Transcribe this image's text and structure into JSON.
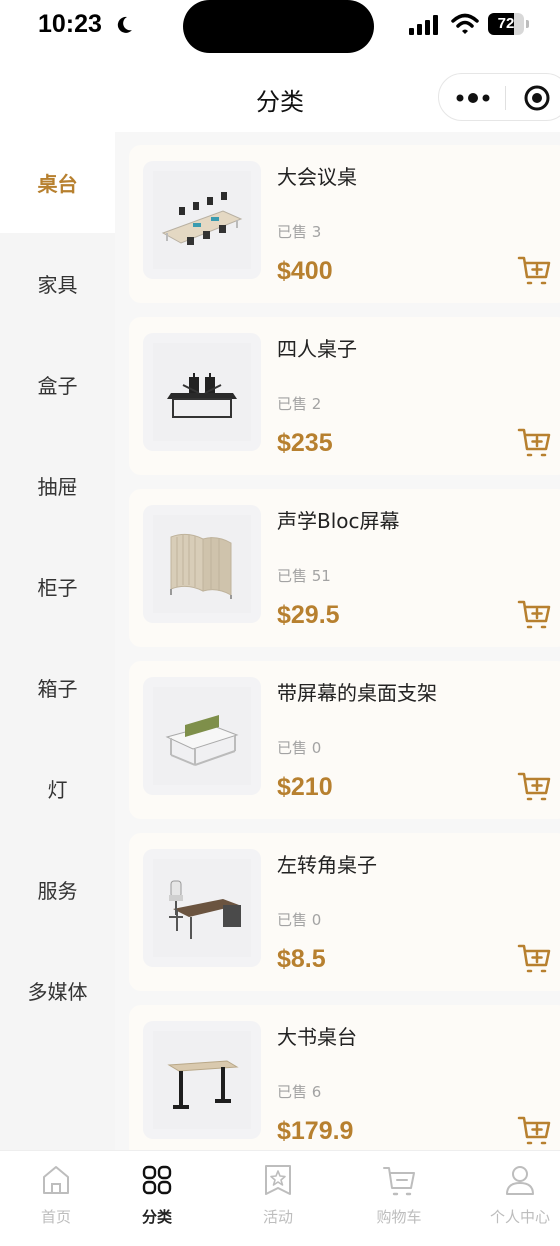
{
  "status_bar": {
    "time": "10:23",
    "battery": "72",
    "battery_level": 0.72,
    "icons": [
      "moon-icon",
      "signal-icon",
      "wifi-icon",
      "battery-icon"
    ]
  },
  "header": {
    "title": "分类",
    "capsule_icons": [
      "more-dots-icon",
      "close-target-icon"
    ]
  },
  "sidebar": {
    "items": [
      {
        "label": "桌台",
        "active": true
      },
      {
        "label": "家具"
      },
      {
        "label": "盒子"
      },
      {
        "label": "抽屉"
      },
      {
        "label": "柜子"
      },
      {
        "label": "箱子"
      },
      {
        "label": "灯"
      },
      {
        "label": "服务"
      },
      {
        "label": "多媒体"
      }
    ]
  },
  "products": [
    {
      "name": "大会议桌",
      "sold": "已售 3",
      "price": "$400",
      "image_icon": "conference-table-icon"
    },
    {
      "name": "四人桌子",
      "sold": "已售 2",
      "price": "$235",
      "image_icon": "four-person-desk-icon"
    },
    {
      "name": "声学Bloc屏幕",
      "sold": "已售 51",
      "price": "$29.5",
      "image_icon": "acoustic-screen-icon"
    },
    {
      "name": "带屏幕的桌面支架",
      "sold": "已售 0",
      "price": "$210",
      "image_icon": "desk-with-screen-icon"
    },
    {
      "name": "左转角桌子",
      "sold": "已售 0",
      "price": "$8.5",
      "image_icon": "corner-desk-icon"
    },
    {
      "name": "大书桌台",
      "sold": "已售 6",
      "price": "$179.9",
      "image_icon": "standing-desk-icon"
    }
  ],
  "tab_bar": {
    "items": [
      {
        "label": "首页",
        "icon": "home-icon"
      },
      {
        "label": "分类",
        "icon": "category-grid-icon",
        "active": true
      },
      {
        "label": "活动",
        "icon": "activity-star-icon"
      },
      {
        "label": "购物车",
        "icon": "cart-icon"
      },
      {
        "label": "个人中心",
        "icon": "user-icon"
      }
    ]
  },
  "colors": {
    "accent": "#b7802f",
    "sidebar_bg": "#f5f5f5",
    "card_bg": "#fdfbf7"
  }
}
